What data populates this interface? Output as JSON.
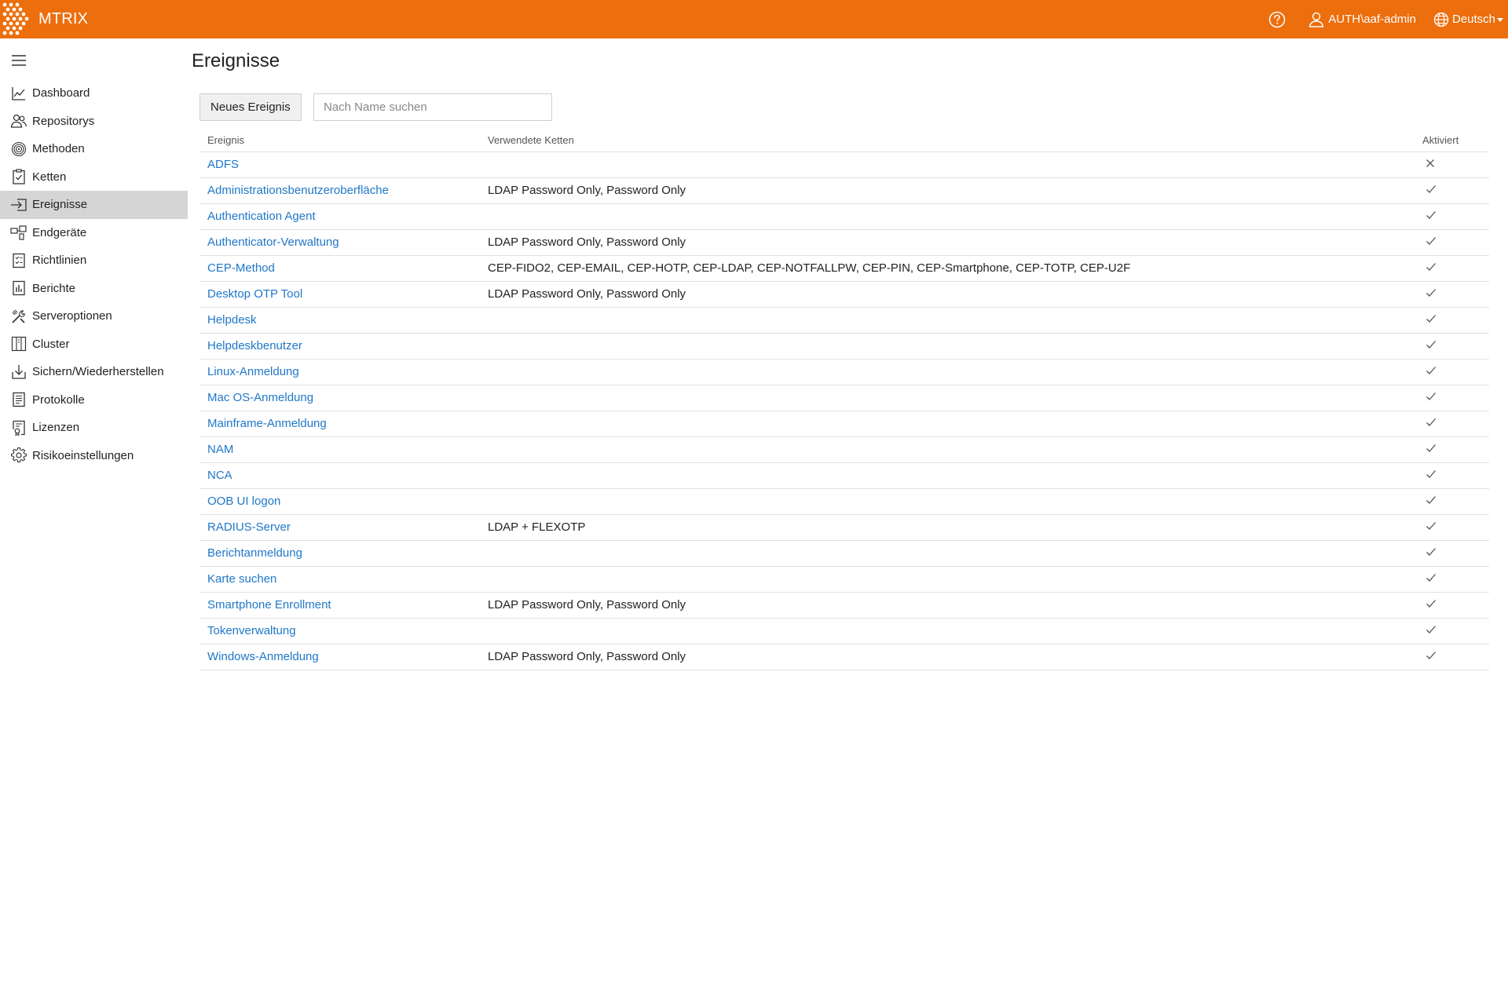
{
  "header": {
    "brand": "MTRIX",
    "user": "AUTH\\aaf-admin",
    "language": "Deutsch",
    "icons": {
      "help": "help-circle-icon",
      "user": "user-icon",
      "language": "globe-icon"
    }
  },
  "sidebar": {
    "items": [
      {
        "label": "Dashboard",
        "icon": "chart-icon"
      },
      {
        "label": "Repositorys",
        "icon": "users-icon"
      },
      {
        "label": "Methoden",
        "icon": "fingerprint-icon"
      },
      {
        "label": "Ketten",
        "icon": "clipboard-check-icon"
      },
      {
        "label": "Ereignisse",
        "icon": "login-arrow-icon",
        "active": true
      },
      {
        "label": "Endgeräte",
        "icon": "devices-icon"
      },
      {
        "label": "Richtlinien",
        "icon": "checklist-icon"
      },
      {
        "label": "Berichte",
        "icon": "report-icon"
      },
      {
        "label": "Serveroptionen",
        "icon": "tools-icon"
      },
      {
        "label": "Cluster",
        "icon": "cluster-icon"
      },
      {
        "label": "Sichern/Wiederherstellen",
        "icon": "download-icon"
      },
      {
        "label": "Protokolle",
        "icon": "document-lines-icon"
      },
      {
        "label": "Lizenzen",
        "icon": "license-icon"
      },
      {
        "label": "Risikoeinstellungen",
        "icon": "gear-icon"
      }
    ]
  },
  "main": {
    "title": "Ereignisse",
    "new_button": "Neues Ereignis",
    "search_placeholder": "Nach Name suchen",
    "columns": {
      "name": "Ereignis",
      "chains": "Verwendete Ketten",
      "active": "Aktiviert"
    },
    "rows": [
      {
        "name": "ADFS",
        "chains": "",
        "active": false
      },
      {
        "name": "Administrationsbenutzeroberfläche",
        "chains": "LDAP Password Only, Password Only",
        "active": true
      },
      {
        "name": "Authentication Agent",
        "chains": "",
        "active": true
      },
      {
        "name": "Authenticator-Verwaltung",
        "chains": "LDAP Password Only, Password Only",
        "active": true
      },
      {
        "name": "CEP-Method",
        "chains": "CEP-FIDO2, CEP-EMAIL, CEP-HOTP, CEP-LDAP, CEP-NOTFALLPW, CEP-PIN, CEP-Smartphone, CEP-TOTP, CEP-U2F",
        "active": true
      },
      {
        "name": "Desktop OTP Tool",
        "chains": "LDAP Password Only, Password Only",
        "active": true
      },
      {
        "name": "Helpdesk",
        "chains": "",
        "active": true
      },
      {
        "name": "Helpdeskbenutzer",
        "chains": "",
        "active": true
      },
      {
        "name": "Linux-Anmeldung",
        "chains": "",
        "active": true
      },
      {
        "name": "Mac OS-Anmeldung",
        "chains": "",
        "active": true
      },
      {
        "name": "Mainframe-Anmeldung",
        "chains": "",
        "active": true
      },
      {
        "name": "NAM",
        "chains": "",
        "active": true
      },
      {
        "name": "NCA",
        "chains": "",
        "active": true
      },
      {
        "name": "OOB UI logon",
        "chains": "",
        "active": true
      },
      {
        "name": "RADIUS-Server",
        "chains": "LDAP + FLEXOTP",
        "active": true
      },
      {
        "name": "Berichtanmeldung",
        "chains": "",
        "active": true
      },
      {
        "name": "Karte suchen",
        "chains": "",
        "active": true
      },
      {
        "name": "Smartphone Enrollment",
        "chains": "LDAP Password Only, Password Only",
        "active": true
      },
      {
        "name": "Tokenverwaltung",
        "chains": "",
        "active": true
      },
      {
        "name": "Windows-Anmeldung",
        "chains": "LDAP Password Only, Password Only",
        "active": true
      }
    ]
  },
  "colors": {
    "header": "#ec6e0c",
    "link": "#1f77c8",
    "active_nav": "#d5d5d5"
  }
}
